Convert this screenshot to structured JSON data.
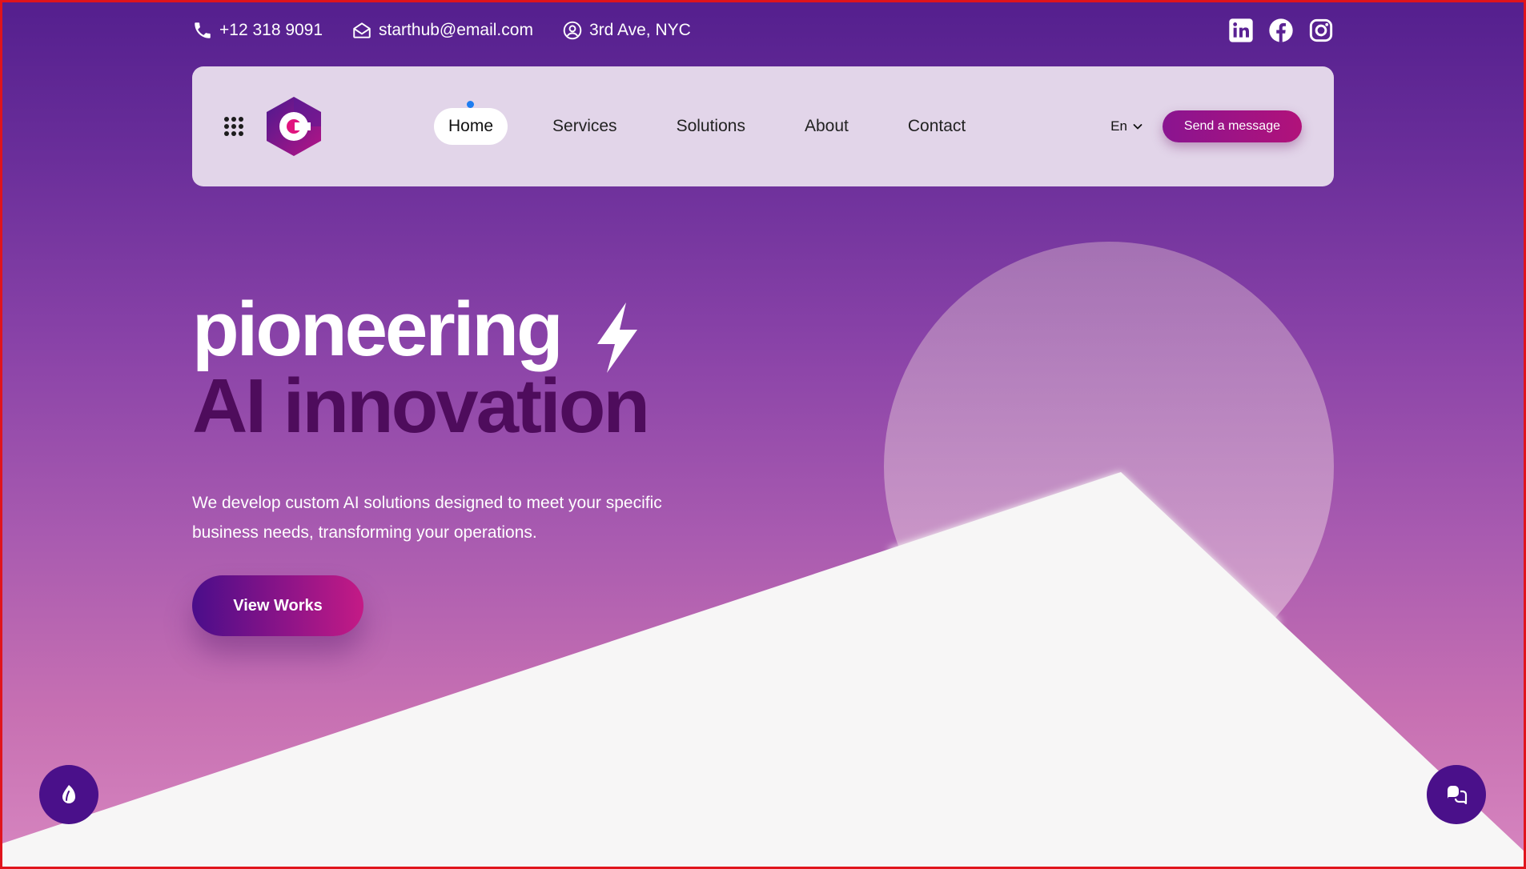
{
  "topbar": {
    "phone": "+12 318 9091",
    "email": "starthub@email.com",
    "address": "3rd Ave, NYC",
    "socials": [
      "linkedin-icon",
      "facebook-icon",
      "instagram-icon"
    ]
  },
  "nav": {
    "logo_letter": "C",
    "items": [
      {
        "label": "Home",
        "active": true
      },
      {
        "label": "Services",
        "active": false
      },
      {
        "label": "Solutions",
        "active": false
      },
      {
        "label": "About",
        "active": false
      },
      {
        "label": "Contact",
        "active": false
      }
    ],
    "language": "En",
    "cta": "Send a message"
  },
  "hero": {
    "title_line1": "pioneering",
    "title_line2": "AI innovation",
    "description": "We develop custom AI solutions designed to meet your specific business needs, transforming your operations.",
    "button": "View Works"
  },
  "floating": {
    "left_icon": "leaf-icon",
    "right_icon": "chat-icon"
  },
  "colors": {
    "accent": "#4a108a",
    "title_dark": "#4e0c5c",
    "nav_bg": "#e2d5e9",
    "cta": "#a0127f",
    "active_dot": "#1e7df0"
  }
}
